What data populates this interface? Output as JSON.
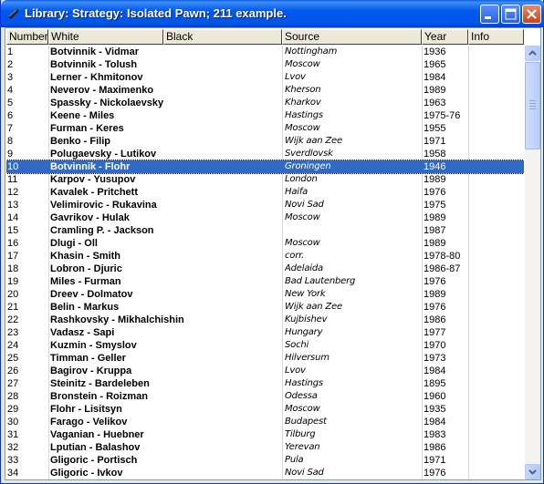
{
  "window": {
    "title": "Library: Strategy: Isolated Pawn; 211 example."
  },
  "columns": [
    "Number",
    "White",
    "Black",
    "Source",
    "Year",
    "Info"
  ],
  "selected_row": 10,
  "rows": [
    {
      "n": "1",
      "game": "Botvinnik - Vidmar",
      "source": "Nottingham",
      "year": "1936"
    },
    {
      "n": "2",
      "game": "Botvinnik - Tolush",
      "source": "Moscow",
      "year": "1965"
    },
    {
      "n": "3",
      "game": "Lerner - Khmitonov",
      "source": "Lvov",
      "year": "1984"
    },
    {
      "n": "4",
      "game": "Neverov - Maximenko",
      "source": "Kherson",
      "year": "1989"
    },
    {
      "n": "5",
      "game": "Spassky - Nickolaevsky",
      "source": "Kharkov",
      "year": "1963"
    },
    {
      "n": "6",
      "game": "Keene - Miles",
      "source": "Hastings",
      "year": "1975-76"
    },
    {
      "n": "7",
      "game": "Furman - Keres",
      "source": "Moscow",
      "year": "1955"
    },
    {
      "n": "8",
      "game": "Benko - Filip",
      "source": "Wijk aan Zee",
      "year": "1971"
    },
    {
      "n": "9",
      "game": "Polugaevsky - Lutikov",
      "source": "Sverdlovsk",
      "year": "1958"
    },
    {
      "n": "10",
      "game": "Botvinnik - Flohr",
      "source": "Groningen",
      "year": "1946"
    },
    {
      "n": "11",
      "game": "Karpov - Yusupov",
      "source": "London",
      "year": "1989"
    },
    {
      "n": "12",
      "game": "Kavalek - Pritchett",
      "source": "Haifa",
      "year": "1976"
    },
    {
      "n": "13",
      "game": "Velimirovic - Rukavina",
      "source": "Novi Sad",
      "year": "1975"
    },
    {
      "n": "14",
      "game": "Gavrikov - Hulak",
      "source": "Moscow",
      "year": "1989"
    },
    {
      "n": "15",
      "game": "Cramling P. - Jackson",
      "source": "",
      "year": "1987"
    },
    {
      "n": "16",
      "game": "Dlugi - Oll",
      "source": "Moscow",
      "year": "1989"
    },
    {
      "n": "17",
      "game": "Khasin - Smith",
      "source": "corr.",
      "year": "1978-80"
    },
    {
      "n": "18",
      "game": "Lobron - Djuric",
      "source": "Adelaida",
      "year": "1986-87"
    },
    {
      "n": "19",
      "game": "Miles - Furman",
      "source": "Bad Lautenberg",
      "year": "1976"
    },
    {
      "n": "20",
      "game": "Dreev - Dolmatov",
      "source": "New York",
      "year": "1989"
    },
    {
      "n": "21",
      "game": "Belin - Markus",
      "source": "Wijk aan Zee",
      "year": "1976"
    },
    {
      "n": "22",
      "game": "Rashkovsky - Mikhalchishin",
      "source": "Kujbishev",
      "year": "1986"
    },
    {
      "n": "23",
      "game": "Vadasz - Sapi",
      "source": "Hungary",
      "year": "1977"
    },
    {
      "n": "24",
      "game": "Kuzmin - Smyslov",
      "source": "Sochi",
      "year": "1970"
    },
    {
      "n": "25",
      "game": "Timman - Geller",
      "source": "Hilversum",
      "year": "1973"
    },
    {
      "n": "26",
      "game": "Bagirov - Kruppa",
      "source": "Lvov",
      "year": "1984"
    },
    {
      "n": "27",
      "game": "Steinitz - Bardeleben",
      "source": "Hastings",
      "year": "1895"
    },
    {
      "n": "28",
      "game": "Bronstein - Roizman",
      "source": "Odessa",
      "year": "1960"
    },
    {
      "n": "29",
      "game": "Flohr - Lisitsyn",
      "source": "Moscow",
      "year": "1935"
    },
    {
      "n": "30",
      "game": "Farago - Velikov",
      "source": "Budapest",
      "year": "1984"
    },
    {
      "n": "31",
      "game": "Vaganian - Huebner",
      "source": "Tilburg",
      "year": "1983"
    },
    {
      "n": "32",
      "game": "Lputian - Balashov",
      "source": "Yerevan",
      "year": "1986"
    },
    {
      "n": "33",
      "game": "Gligoric - Portisch",
      "source": "Pula",
      "year": "1971"
    },
    {
      "n": "34",
      "game": "Gligoric - Ivkov",
      "source": "Novi Sad",
      "year": "1976"
    }
  ]
}
